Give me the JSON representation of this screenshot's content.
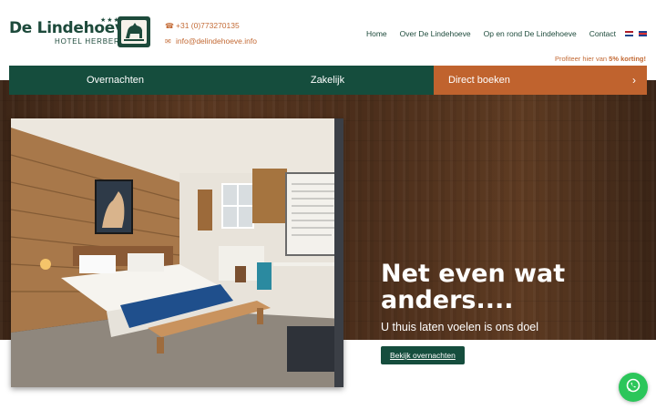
{
  "brand": {
    "name": "De Lindehoeve",
    "stars": "★★★",
    "subtitle": "HOTEL  HERBERG"
  },
  "contact": {
    "phone": "+31 (0)773270135",
    "email": "info@delindehoeve.info"
  },
  "nav": {
    "items": [
      "Home",
      "Over De Lindehoeve",
      "Op en rond De Lindehoeve",
      "Contact"
    ],
    "active": "Home"
  },
  "promo": {
    "text": "Profiteer hier van ",
    "highlight": "5% korting!"
  },
  "menubar": {
    "overnachten": "Overnachten",
    "zakelijk": "Zakelijk",
    "boeken": "Direct boeken",
    "boeken_icon": "chevron-right-icon"
  },
  "hero": {
    "title": "Net even wat anders....",
    "subtitle": "U thuis laten voelen is ons doel",
    "button": "Bekijk overnachten"
  },
  "colors": {
    "brand_green": "#154d3d",
    "accent_orange": "#c0632e",
    "whatsapp_green": "#2bc65a"
  },
  "icons": {
    "phone": "phone-icon",
    "email": "envelope-icon",
    "whatsapp": "whatsapp-icon"
  }
}
